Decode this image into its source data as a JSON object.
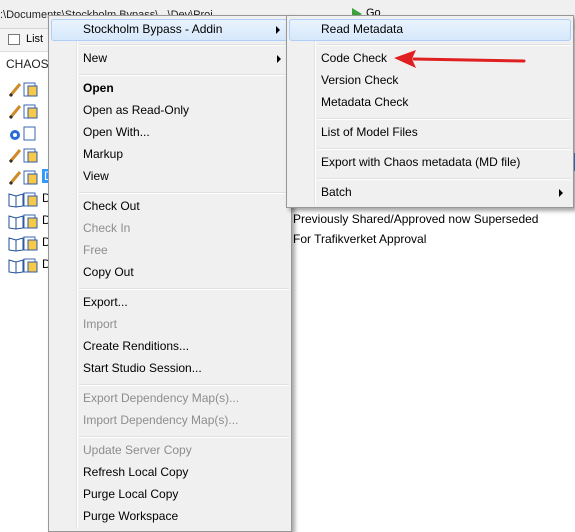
{
  "window": {
    "address_text": ":\\Documents\\Stockholm Bypass\\...\\Dev\\Proj...",
    "go_label": "Go",
    "view_mode_label": "List",
    "column_header": "CHAOS"
  },
  "files": [
    {
      "icon": "pencil-document-icon",
      "label": ""
    },
    {
      "icon": "pencil-document-icon",
      "label": ""
    },
    {
      "icon": "linked-document-icon",
      "label": ""
    },
    {
      "icon": "pencil-document-icon",
      "label": ""
    },
    {
      "icon": "pencil-document-icon",
      "label": "D",
      "selected": true
    },
    {
      "icon": "book-document-icon",
      "label": "D"
    },
    {
      "icon": "book-document-icon",
      "label": "D"
    },
    {
      "icon": "book-document-icon",
      "label": "D"
    },
    {
      "icon": "book-document-icon",
      "label": "D"
    }
  ],
  "status_lines": [
    "Previously Shared/Approved now Superseded",
    "For Trafikverket Approval"
  ],
  "context_menu": {
    "items": [
      {
        "label": "Stockholm Bypass - Addin",
        "submenu": true,
        "highlighted": true
      },
      {
        "label": "New",
        "submenu": true
      },
      {
        "label": "Open",
        "bold": true
      },
      {
        "label": "Open as Read-Only"
      },
      {
        "label": "Open With..."
      },
      {
        "label": "Markup"
      },
      {
        "label": "View"
      },
      {
        "label": "Check Out"
      },
      {
        "label": "Check In",
        "disabled": true
      },
      {
        "label": "Free",
        "disabled": true
      },
      {
        "label": "Copy Out"
      },
      {
        "label": "Export..."
      },
      {
        "label": "Import",
        "disabled": true
      },
      {
        "label": "Create Renditions..."
      },
      {
        "label": "Start Studio Session..."
      },
      {
        "label": "Export Dependency Map(s)...",
        "disabled": true
      },
      {
        "label": "Import Dependency Map(s)...",
        "disabled": true
      },
      {
        "label": "Update Server Copy",
        "disabled": true
      },
      {
        "label": "Refresh Local Copy"
      },
      {
        "label": "Purge Local Copy"
      },
      {
        "label": "Purge Workspace"
      }
    ]
  },
  "submenu": {
    "items": [
      {
        "label": "Read Metadata",
        "highlighted": true
      },
      {
        "label": "Code Check"
      },
      {
        "label": "Version Check"
      },
      {
        "label": "Metadata Check"
      },
      {
        "label": "List of Model Files"
      },
      {
        "label": "Export with Chaos metadata (MD file)"
      },
      {
        "label": "Batch",
        "submenu": true
      }
    ]
  },
  "annotation": {
    "color": "#e02020",
    "points_to": "Code Check"
  },
  "colors": {
    "selection": "#3399ff",
    "menu_bg": "#f0f0f0",
    "highlight_border": "#aecff7"
  }
}
